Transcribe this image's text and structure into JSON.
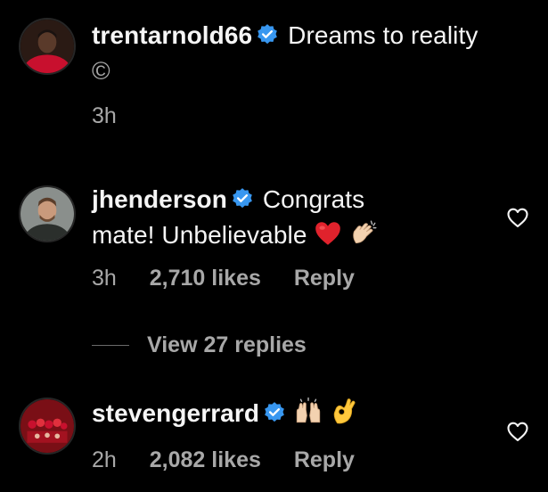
{
  "comments": [
    {
      "username": "trentarnold66",
      "text": "Dreams to reality",
      "text2": "©",
      "time": "3h"
    },
    {
      "username": "jhenderson",
      "text": "Congrats",
      "text2": "mate! Unbelievable",
      "time": "3h",
      "likes": "2,710 likes",
      "reply": "Reply"
    },
    {
      "username": "stevengerrard",
      "time": "2h",
      "likes": "2,082 likes",
      "reply": "Reply"
    }
  ],
  "view_replies": "View 27 replies",
  "colors": {
    "background": "#000000",
    "text": "#f5f5f5",
    "meta": "#a8a8a8",
    "verified": "#3897f0",
    "heart_emoji": "#e0222c"
  },
  "icons": [
    "verified-badge-icon",
    "heart-outline-icon",
    "red-heart-emoji-icon",
    "clapping-hands-emoji-icon",
    "raising-hands-emoji-icon",
    "ok-hand-emoji-icon",
    "copyright-icon"
  ]
}
